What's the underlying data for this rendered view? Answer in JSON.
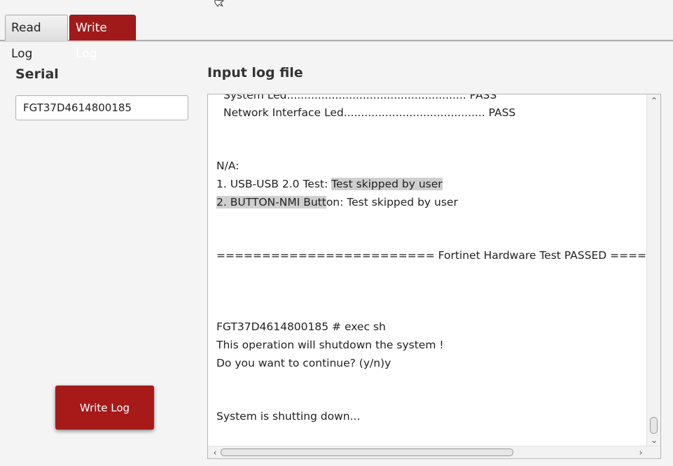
{
  "tabs": {
    "read_log": "Read Log",
    "write_log": "Write Log"
  },
  "serial": {
    "label": "Serial",
    "value": "FGT37D4614800185"
  },
  "log": {
    "label": "Input log file",
    "lines": {
      "l0": "System Led.................................................... PASS",
      "l1": "Network Interface Led......................................... PASS",
      "l2": "N/A:",
      "l3a": "1. USB-USB 2.0 Test: ",
      "l3b": "Test skipped by user",
      "l4a": "2. BUTTON-NMI Butt",
      "l4b": "on: Test skipped by user",
      "l5": "======================== Fortinet Hardware Test PASSED ====",
      "l6": "FGT37D4614800185 # exec sh",
      "l7": "This operation will shutdown the system !",
      "l8": "Do you want to continue? (y/n)y",
      "l9": "System is shutting down..."
    }
  },
  "actions": {
    "write_log_button": "Write Log"
  },
  "colors": {
    "accent": "#a61a1a"
  }
}
